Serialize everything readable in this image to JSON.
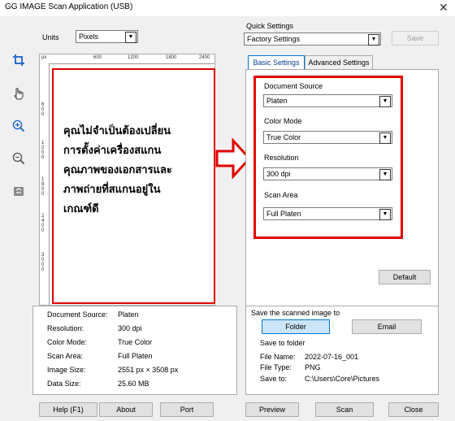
{
  "window": {
    "title": "GG IMAGE Scan Application (USB)",
    "close_glyph": "✕"
  },
  "units": {
    "label": "Units",
    "value": "Pixels"
  },
  "ruler": {
    "unit_label": "px",
    "h_ticks": [
      "600",
      "1200",
      "1800",
      "2400"
    ],
    "v_ticks": [
      "600",
      "1200",
      "1800",
      "2400",
      "3000"
    ]
  },
  "annotation": {
    "lines": [
      "คุณไม่จำเป็นต้องเปลี่ยน",
      "การตั้งค่าเครื่องสแกน",
      "คุณภาพของเอกสารและ",
      "ภาพถ่ายที่สแกนอยู่ใน",
      "เกณฑ์ดี"
    ],
    "arrow_color": "#e10000"
  },
  "sidebar_tools": [
    {
      "icon": "crop-icon",
      "glyph": "⌗"
    },
    {
      "icon": "hand-icon",
      "glyph": "☝"
    },
    {
      "icon": "zoom-in-icon",
      "glyph": "⊕"
    },
    {
      "icon": "zoom-out-icon",
      "glyph": "⊖"
    },
    {
      "icon": "recycle-bin-icon",
      "glyph": "♻"
    }
  ],
  "quick_settings": {
    "label": "Quick Settings",
    "value": "Factory Settings",
    "save_label": "Save"
  },
  "tabs": [
    {
      "label": "Basic Settings",
      "active": true
    },
    {
      "label": "Advanced Settings",
      "active": false
    }
  ],
  "basic_settings": {
    "document_source": {
      "label": "Document Source",
      "value": "Platen"
    },
    "color_mode": {
      "label": "Color Mode",
      "value": "True Color"
    },
    "resolution": {
      "label": "Resolution",
      "value": "300 dpi"
    },
    "scan_area": {
      "label": "Scan Area",
      "value": "Full Platen"
    },
    "default_label": "Default"
  },
  "summary": [
    {
      "key": "Document Source:",
      "value": "Platen"
    },
    {
      "key": "Resolution:",
      "value": "300 dpi"
    },
    {
      "key": "Color Mode:",
      "value": "True Color"
    },
    {
      "key": "Scan Area:",
      "value": "Full Platen"
    },
    {
      "key": "Image Size:",
      "value": "2551 px × 3508 px"
    },
    {
      "key": "Data Size:",
      "value": "25.60 MB"
    }
  ],
  "save_panel": {
    "heading": "Save the scanned image to",
    "folder_label": "Folder",
    "email_label": "Email",
    "save_to_folder": "Save to folder",
    "file_name_key": "File Name:",
    "file_name": "2022-07-16_001",
    "file_type_key": "File Type:",
    "file_type": "PNG",
    "save_to_key": "Save to:",
    "save_to": "C:\\Users\\Core\\Pictures"
  },
  "bottom_buttons": {
    "help": "Help (F1)",
    "about": "About",
    "port": "Port",
    "preview": "Preview",
    "scan": "Scan",
    "close": "Close"
  },
  "colors": {
    "highlight_red": "#e10000",
    "accent_blue": "#0078d7"
  }
}
